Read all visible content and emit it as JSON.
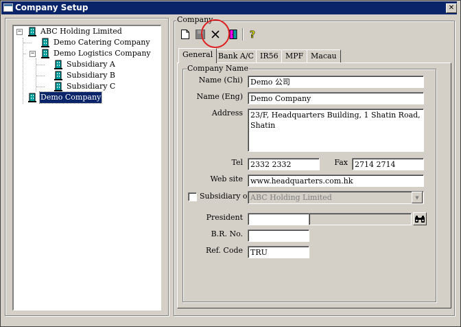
{
  "window": {
    "title": "Company Setup",
    "close_glyph": "✕"
  },
  "tree": {
    "nodes": [
      {
        "label": "ABC Holding Limited",
        "expander": "−"
      },
      {
        "label": "Demo Catering Company"
      },
      {
        "label": "Demo Logistics Company",
        "expander": "−"
      },
      {
        "label": "Subsidiary A"
      },
      {
        "label": "Subsidiary B"
      },
      {
        "label": "Subsidiary C"
      },
      {
        "label": "Demo Company",
        "selected": true
      }
    ]
  },
  "company_group": {
    "title": "Company"
  },
  "toolbar": {
    "buttons": [
      {
        "icon": "new-document-icon"
      },
      {
        "icon": "save-icon"
      },
      {
        "icon": "delete-icon"
      },
      {
        "icon": "exit-door-icon"
      },
      {
        "icon": "help-icon"
      }
    ],
    "highlight_color": "#e02020"
  },
  "tabs": [
    {
      "label": "General",
      "active": true
    },
    {
      "label": "Bank A/C"
    },
    {
      "label": "IR56"
    },
    {
      "label": "MPF"
    },
    {
      "label": "Macau"
    }
  ],
  "form": {
    "group_title": "Company Name",
    "name_chi": {
      "label": "Name (Chi)",
      "value": "Demo 公司"
    },
    "name_eng": {
      "label": "Name (Eng)",
      "value": "Demo Company"
    },
    "address": {
      "label": "Address",
      "value": "23/F, Headquarters Building, 1 Shatin Road, Shatin"
    },
    "tel": {
      "label": "Tel",
      "value": "2332 2332"
    },
    "fax": {
      "label": "Fax",
      "value": "2714 2714"
    },
    "website": {
      "label": "Web site",
      "value": "www.headquarters.com.hk"
    },
    "subsidiary_of": {
      "label": "Subsidiary of :",
      "value": "ABC Holding Limited",
      "checked": false
    },
    "president": {
      "label": "President",
      "code": "",
      "name": ""
    },
    "br_no": {
      "label": "B.R. No.",
      "value": ""
    },
    "ref_code": {
      "label": "Ref. Code",
      "value": "TRU"
    }
  },
  "colors": {
    "titlebar": "#0a246a",
    "selection": "#0a246a",
    "face": "#d4d0c8"
  }
}
